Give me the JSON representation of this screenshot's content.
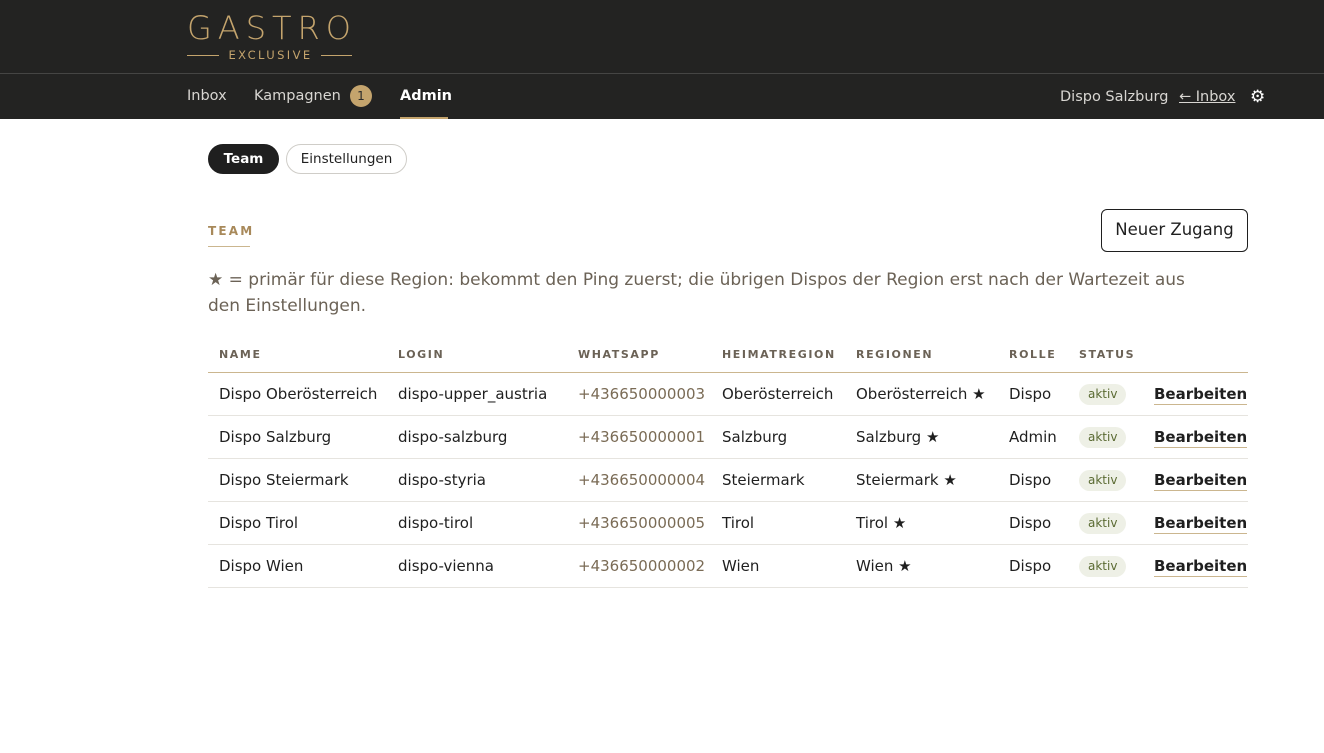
{
  "brand": {
    "name": "GASTRO",
    "tagline": "EXCLUSIVE",
    "accent": "#c4a46d"
  },
  "nav": {
    "items": [
      {
        "label": "Inbox"
      },
      {
        "label": "Kampagnen",
        "badge": "1"
      },
      {
        "label": "Admin",
        "active": true
      }
    ],
    "user": "Dispo Salzburg",
    "back_link": "← Inbox",
    "settings_icon": "gear-icon"
  },
  "subtabs": [
    {
      "label": "Team",
      "active": true
    },
    {
      "label": "Einstellungen",
      "active": false
    }
  ],
  "section": {
    "title": "TEAM",
    "new_button": "Neuer Zugang",
    "hint": "★ = primär für diese Region: bekommt den Ping zuerst; die übrigen Dispos der Region erst nach der Wartezeit aus den Einstellungen."
  },
  "table": {
    "headers": [
      "NAME",
      "LOGIN",
      "WHATSAPP",
      "HEIMATREGION",
      "REGIONEN",
      "ROLLE",
      "STATUS"
    ],
    "edit_label": "Bearbeiten",
    "rows": [
      {
        "name": "Dispo Oberösterreich",
        "login": "dispo-upper_austria",
        "whatsapp": "+436650000003",
        "home": "Oberösterreich",
        "regions": "Oberösterreich ★",
        "role": "Dispo",
        "status": "aktiv"
      },
      {
        "name": "Dispo Salzburg",
        "login": "dispo-salzburg",
        "whatsapp": "+436650000001",
        "home": "Salzburg",
        "regions": "Salzburg ★",
        "role": "Admin",
        "status": "aktiv"
      },
      {
        "name": "Dispo Steiermark",
        "login": "dispo-styria",
        "whatsapp": "+436650000004",
        "home": "Steiermark",
        "regions": "Steiermark ★",
        "role": "Dispo",
        "status": "aktiv"
      },
      {
        "name": "Dispo Tirol",
        "login": "dispo-tirol",
        "whatsapp": "+436650000005",
        "home": "Tirol",
        "regions": "Tirol ★",
        "role": "Dispo",
        "status": "aktiv"
      },
      {
        "name": "Dispo Wien",
        "login": "dispo-vienna",
        "whatsapp": "+436650000002",
        "home": "Wien",
        "regions": "Wien ★",
        "role": "Dispo",
        "status": "aktiv"
      }
    ]
  }
}
